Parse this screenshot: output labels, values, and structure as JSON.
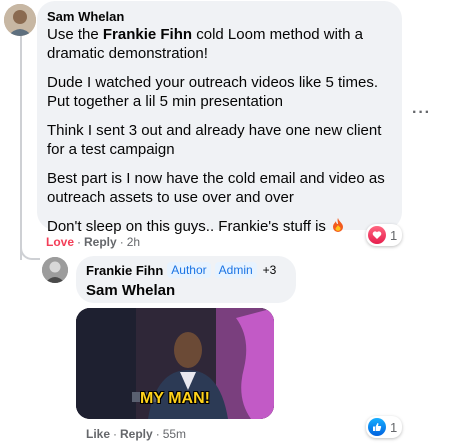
{
  "comment": {
    "author": "Sam Whelan",
    "paragraphs": [
      {
        "before": "Use the ",
        "bold": "Frankie Fihn",
        "after": " cold Loom method with a dramatic demonstration!"
      },
      {
        "text": "Dude I watched your outreach videos like 5 times. Put together a lil 5 min presentation"
      },
      {
        "text": "Think I sent 3 out and already have one new client for a test campaign"
      },
      {
        "text": "Best part is I now have the cold email and video as outreach assets to use over and over"
      },
      {
        "text": "Don't sleep on this guys.. Frankie's stuff is "
      }
    ],
    "reaction": {
      "icon": "heart-icon",
      "count": "1",
      "color": "#f33e58"
    },
    "actions": {
      "love": "Love",
      "reply": "Reply",
      "time": "2h"
    },
    "more_icon": "more-options-icon"
  },
  "reply": {
    "author": "Frankie Fihn",
    "badges": [
      "Author",
      "Admin"
    ],
    "badge_more": "+3",
    "text": "Sam Whelan",
    "gif_caption": "MY MAN!",
    "reaction": {
      "icon": "thumbs-up-icon",
      "count": "1",
      "color": "#1877f2"
    },
    "actions": {
      "like": "Like",
      "reply": "Reply",
      "time": "55m"
    }
  }
}
